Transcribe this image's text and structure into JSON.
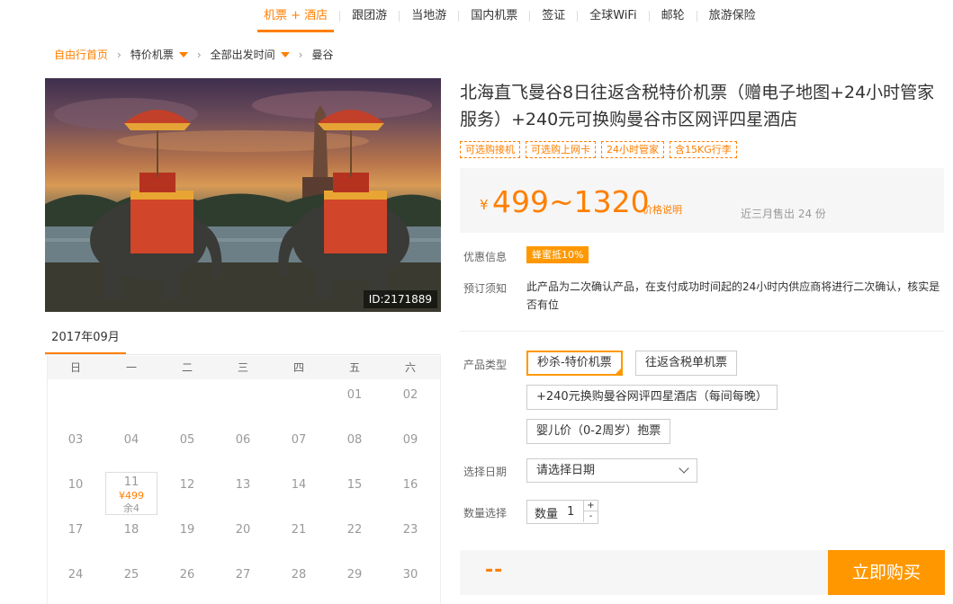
{
  "nav": {
    "items": [
      {
        "label": "机票 + 酒店",
        "active": true
      },
      {
        "label": "跟团游"
      },
      {
        "label": "当地游"
      },
      {
        "label": "国内机票"
      },
      {
        "label": "签证"
      },
      {
        "label": "全球WiFi"
      },
      {
        "label": "邮轮"
      },
      {
        "label": "旅游保险"
      }
    ]
  },
  "breadcrumb": {
    "home": "自由行首页",
    "level1": "特价机票",
    "level2": "全部出发时间",
    "current": "曼谷"
  },
  "hero": {
    "image_id": "ID:2171889"
  },
  "calendar": {
    "month": "2017年09月",
    "weekdays": [
      "日",
      "一",
      "二",
      "三",
      "四",
      "五",
      "六"
    ],
    "rows": [
      [
        "",
        "",
        "",
        "",
        "",
        "01",
        "02"
      ],
      [
        "03",
        "04",
        "05",
        "06",
        "07",
        "08",
        "09"
      ],
      [
        "10",
        "11",
        "12",
        "13",
        "14",
        "15",
        "16"
      ],
      [
        "17",
        "18",
        "19",
        "20",
        "21",
        "22",
        "23"
      ],
      [
        "24",
        "25",
        "26",
        "27",
        "28",
        "29",
        "30"
      ]
    ],
    "available": {
      "day": "11",
      "price": "¥499",
      "stock": "余4"
    }
  },
  "product": {
    "title": "北海直飞曼谷8日往返含税特价机票（赠电子地图+24小时管家服务）+240元可换购曼谷市区网评四星酒店",
    "tags": [
      "可选购接机",
      "可选购上网卡",
      "24小时管家",
      "含15KG行李"
    ],
    "price_symbol": "¥",
    "price_range": "499~1320",
    "price_note": "价格说明",
    "sold": "近三月售出 24 份",
    "discount_label": "优惠信息",
    "discount_badge": "蜂蜜抵10%",
    "notice_label": "预订须知",
    "notice": "此产品为二次确认产品，在支付成功时间起的24小时内供应商将进行二次确认，核实是否有位",
    "type_label": "产品类型",
    "types": [
      "秒杀-特价机票",
      "往返含税单机票",
      "+240元换购曼谷网评四星酒店（每间每晚）",
      "婴儿价（0-2周岁）抱票"
    ],
    "selected_type": "秒杀-特价机票",
    "date_label": "选择日期",
    "date_placeholder": "请选择日期",
    "qty_label_left": "数量选择",
    "qty_label": "数量",
    "qty_value": "1",
    "qty_plus": "+",
    "qty_minus": "-",
    "total": "--",
    "buy_label": "立即购买"
  },
  "colors": {
    "accent": "#ff7f00",
    "button": "#ff9800"
  }
}
